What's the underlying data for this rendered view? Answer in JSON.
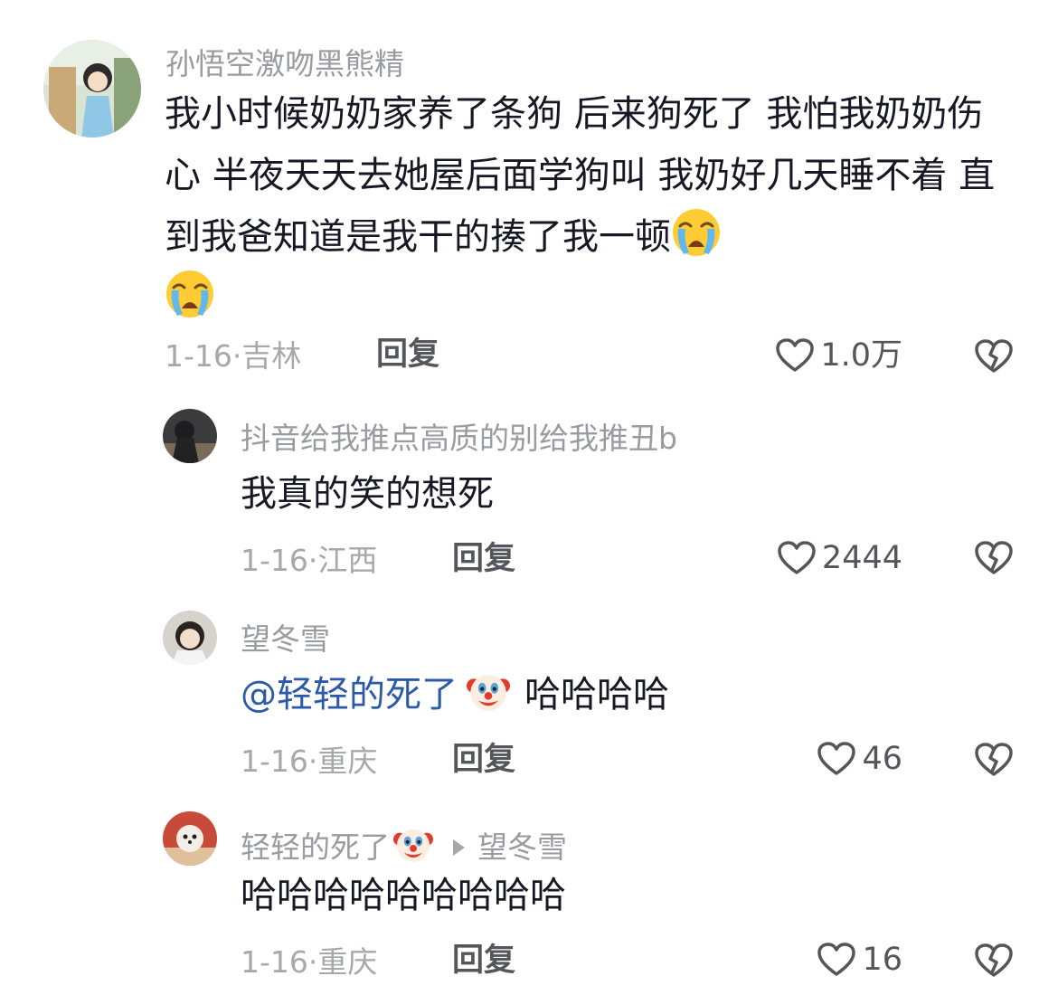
{
  "comments": [
    {
      "username": "孙悟空激吻黑熊精",
      "text": "我小时候奶奶家养了条狗 后来狗死了 我怕我奶奶伤心 半夜天天去她屋后面学狗叫 我奶好几天睡不着 直到我爸知道是我干的揍了我一顿",
      "emojis": [
        "loudly-crying-face-emoji",
        "loudly-crying-face-emoji"
      ],
      "date": "1-16",
      "location": "吉林",
      "reply_label": "回复",
      "likes": "1.0万"
    },
    {
      "username": "抖音给我推点高质的别给我推丑b",
      "text": "我真的笑的想死",
      "date": "1-16",
      "location": "江西",
      "reply_label": "回复",
      "likes": "2444"
    },
    {
      "username": "望冬雪",
      "mention": "@轻轻的死了",
      "mention_emoji": "clown-face-emoji",
      "text": "哈哈哈哈",
      "date": "1-16",
      "location": "重庆",
      "reply_label": "回复",
      "likes": "46"
    },
    {
      "username": "轻轻的死了",
      "username_emoji": "clown-face-emoji",
      "reply_to": "望冬雪",
      "text": "哈哈哈哈哈哈哈哈哈",
      "date": "1-16",
      "location": "重庆",
      "reply_label": "回复",
      "likes": "16"
    }
  ],
  "separator": "·",
  "icons": {
    "like": "heart-outline-icon",
    "dislike": "broken-heart-icon",
    "reply_arrow": "triangle-right-icon"
  },
  "colors": {
    "text": "#161823",
    "username": "#9a9ba0",
    "meta": "#a7a8ac",
    "mention": "#2d5aa8",
    "action": "#55565c"
  }
}
